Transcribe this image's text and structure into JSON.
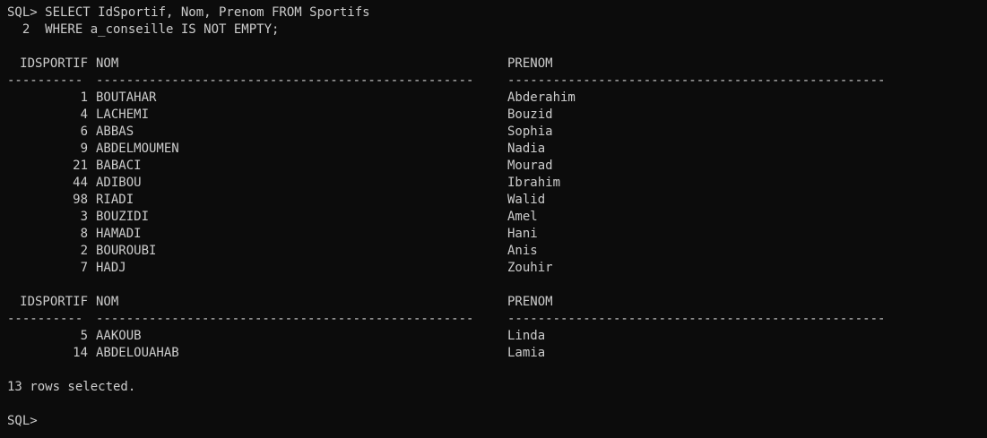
{
  "terminal": {
    "prompt_line1": "SQL> SELECT IdSportif, Nom, Prenom FROM Sportifs",
    "prompt_line2": "  2  WHERE a_conseille IS NOT EMPTY;",
    "headers": {
      "id": "IDSPORTIF",
      "nom": "NOM",
      "prenom": "PRENOM"
    },
    "separators": {
      "id": "----------",
      "nom": "--------------------------------------------------",
      "prenom": "--------------------------------------------------"
    },
    "block1": [
      {
        "id": "1",
        "nom": "BOUTAHAR",
        "prenom": "Abderahim"
      },
      {
        "id": "4",
        "nom": "LACHEMI",
        "prenom": "Bouzid"
      },
      {
        "id": "6",
        "nom": "ABBAS",
        "prenom": "Sophia"
      },
      {
        "id": "9",
        "nom": "ABDELMOUMEN",
        "prenom": "Nadia"
      },
      {
        "id": "21",
        "nom": "BABACI",
        "prenom": "Mourad"
      },
      {
        "id": "44",
        "nom": "ADIBOU",
        "prenom": "Ibrahim"
      },
      {
        "id": "98",
        "nom": "RIADI",
        "prenom": "Walid"
      },
      {
        "id": "3",
        "nom": "BOUZIDI",
        "prenom": "Amel"
      },
      {
        "id": "8",
        "nom": "HAMADI",
        "prenom": "Hani"
      },
      {
        "id": "2",
        "nom": "BOUROUBI",
        "prenom": "Anis"
      },
      {
        "id": "7",
        "nom": "HADJ",
        "prenom": "Zouhir"
      }
    ],
    "block2": [
      {
        "id": "5",
        "nom": "AAKOUB",
        "prenom": "Linda"
      },
      {
        "id": "14",
        "nom": "ABDELOUAHAB",
        "prenom": "Lamia"
      }
    ],
    "summary": "13 rows selected.",
    "final_prompt": "SQL>"
  }
}
